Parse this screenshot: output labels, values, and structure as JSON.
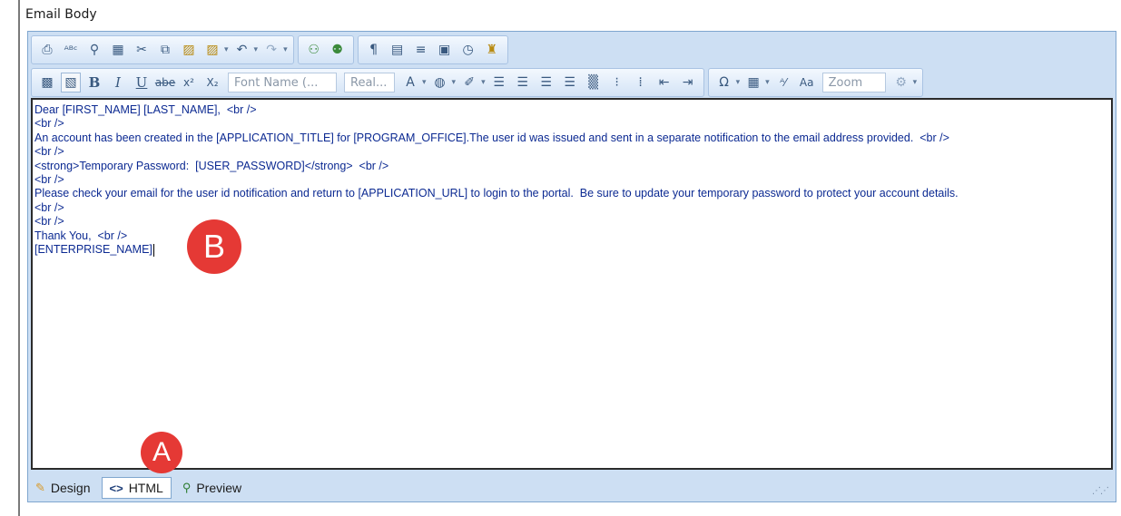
{
  "section_label": "Email Body",
  "toolbar": {
    "row1": [
      {
        "name": "print-icon",
        "glyph": "⎙"
      },
      {
        "name": "spellcheck-icon",
        "glyph": "✓"
      },
      {
        "name": "find-icon",
        "glyph": "🔍"
      },
      {
        "name": "select-all-icon",
        "glyph": "▦"
      },
      {
        "name": "cut-icon",
        "glyph": "✂"
      },
      {
        "name": "copy-icon",
        "glyph": "⧉"
      },
      {
        "name": "paste-icon",
        "glyph": "📋"
      },
      {
        "name": "paste-options-icon",
        "glyph": "📋"
      },
      {
        "name": "undo-icon",
        "glyph": "↶"
      },
      {
        "name": "redo-icon",
        "glyph": "↷"
      },
      {
        "name": "insert-link-icon",
        "glyph": "🔗"
      },
      {
        "name": "remove-link-icon",
        "glyph": "⛓"
      },
      {
        "name": "paragraph-icon",
        "glyph": "¶"
      },
      {
        "name": "insert-date-icon",
        "glyph": "▤"
      },
      {
        "name": "horizontal-rule-icon",
        "glyph": "≡"
      },
      {
        "name": "special-char-icon",
        "glyph": "▣"
      },
      {
        "name": "insert-time-icon",
        "glyph": "◷"
      },
      {
        "name": "format-painter-icon",
        "glyph": "♜"
      }
    ],
    "font_name_placeholder": "Font Name (...",
    "font_size_placeholder": "Real...",
    "zoom_placeholder": "Zoom",
    "bold_label": "B",
    "italic_label": "I",
    "underline_label": "U",
    "strike_label": "abe",
    "superscript_label": "x²",
    "subscript_label": "X₂"
  },
  "html_source": {
    "lines": [
      "Dear [FIRST_NAME] [LAST_NAME],  <br />",
      "<br />",
      "An account has been created in the [APPLICATION_TITLE] for [PROGRAM_OFFICE].The user id was issued and sent in a separate notification to the email address provided.  <br />",
      "<br />",
      "<strong>Temporary Password:  [USER_PASSWORD]</strong>  <br />",
      "<br />",
      "Please check your email for the user id notification and return to [APPLICATION_URL] to login to the portal.  Be sure to update your temporary password to protect your account details.",
      "<br />",
      "<br />",
      "Thank You,  <br />",
      "[ENTERPRISE_NAME]"
    ]
  },
  "callouts": {
    "a": "A",
    "b": "B"
  },
  "mode_tabs": {
    "design": "Design",
    "html": "HTML",
    "preview": "Preview"
  },
  "colors": {
    "accent_callout": "#e53935",
    "code_text": "#0c2a92",
    "editor_chrome": "#cddff3"
  }
}
